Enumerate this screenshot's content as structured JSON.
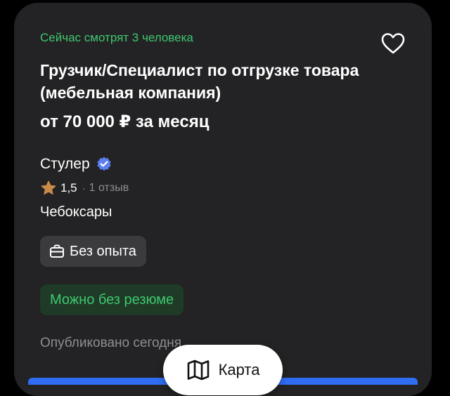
{
  "vacancy": {
    "viewers_text": "Сейчас смотрят 3 человека",
    "title": "Грузчик/Специалист по отгрузке товара (мебельная компания)",
    "salary": "от 70 000 ₽ за месяц",
    "company": {
      "name": "Стулер",
      "verified_icon": "verified-badge-icon",
      "rating": "1,5",
      "separator": "·",
      "reviews": "1 отзыв"
    },
    "city": "Чебоксары",
    "tags": {
      "experience": "Без опыта",
      "resume": "Можно без резюме"
    },
    "published": "Опубликовано сегодня"
  },
  "map_button": {
    "label": "Карта",
    "icon": "map-icon"
  },
  "colors": {
    "background": "#000000",
    "card": "#232325",
    "accent_green": "#3ec86e",
    "chip_gray": "#3b3b3e",
    "chip_green": "#1f3a27",
    "verified_blue": "#5b7ff0",
    "star": "#c98a4a",
    "muted_text": "#8e8e93"
  }
}
